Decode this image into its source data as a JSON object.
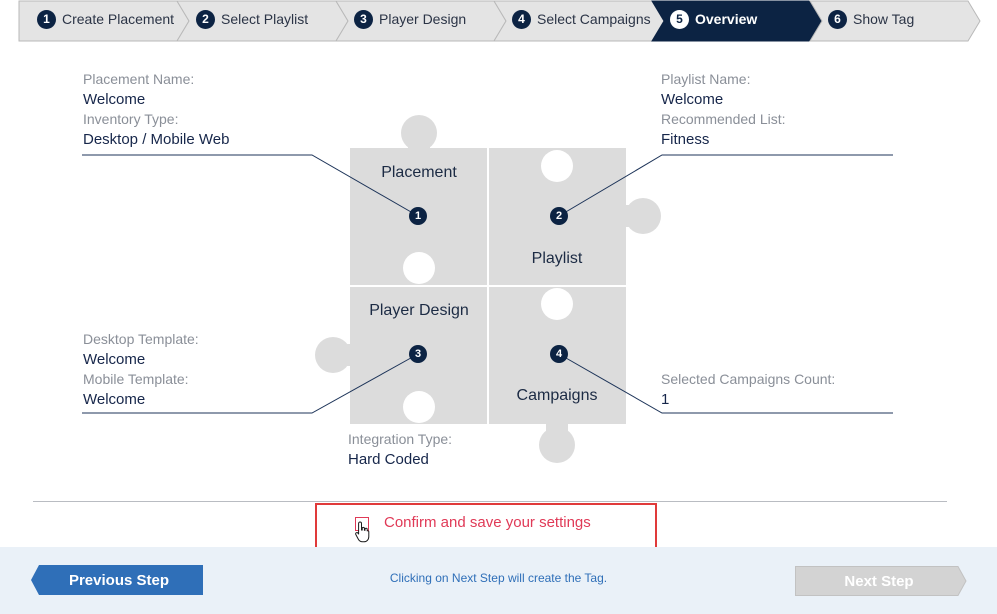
{
  "stepper": {
    "steps": [
      {
        "num": "1",
        "label": "Create Placement"
      },
      {
        "num": "2",
        "label": "Select Playlist"
      },
      {
        "num": "3",
        "label": "Player Design"
      },
      {
        "num": "4",
        "label": "Select Campaigns"
      },
      {
        "num": "5",
        "label": "Overview"
      },
      {
        "num": "6",
        "label": "Show Tag"
      }
    ],
    "active_step": 5
  },
  "overview": {
    "placement": {
      "name_label": "Placement Name:",
      "name_value": "Welcome",
      "inventory_label": "Inventory Type:",
      "inventory_value": "Desktop / Mobile Web"
    },
    "playlist": {
      "name_label": "Playlist Name:",
      "name_value": "Welcome",
      "recommended_label": "Recommended List:",
      "recommended_value": "Fitness"
    },
    "player_design": {
      "desktop_label": "Desktop Template:",
      "desktop_value": "Welcome",
      "mobile_label": "Mobile Template:",
      "mobile_value": "Welcome",
      "integration_label": "Integration Type:",
      "integration_value": "Hard Coded"
    },
    "campaigns": {
      "count_label": "Selected Campaigns Count:",
      "count_value": "1"
    },
    "pieces": [
      {
        "num": "1",
        "title": "Placement"
      },
      {
        "num": "2",
        "title": "Playlist"
      },
      {
        "num": "3",
        "title": "Player Design"
      },
      {
        "num": "4",
        "title": "Campaigns"
      }
    ]
  },
  "confirm": {
    "label": "Confirm and save your settings",
    "checked": false
  },
  "footer": {
    "prev_label": "Previous Step",
    "next_label": "Next Step",
    "note": "Clicking on Next Step will create the Tag."
  },
  "colors": {
    "navy": "#0c2343",
    "puzzle": "#dcdcdc",
    "accent_red": "#e03a57",
    "prev_button": "#2f6fb8",
    "next_button_disabled": "#d3d3d3",
    "footer_bg": "#eaf1f8"
  }
}
